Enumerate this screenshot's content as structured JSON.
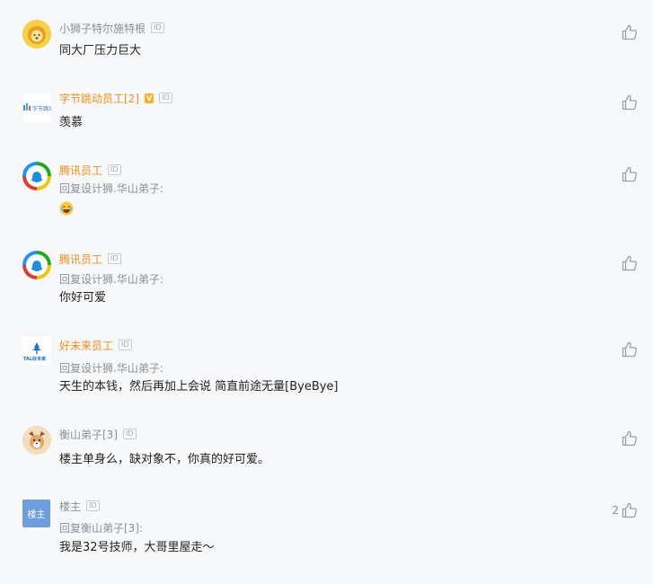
{
  "comments": [
    {
      "author": "小狮子特尔施特根",
      "id_badge": "ID",
      "content": "同大厂压力巨大",
      "like_count": ""
    },
    {
      "author": "字节跳动员工[2]",
      "id_badge": "ID",
      "v_badge": "V",
      "avatar_text": "字节跳动",
      "content": "羡慕",
      "like_count": ""
    },
    {
      "author": "腾讯员工",
      "id_badge": "ID",
      "reply_to": "回复设计狮.华山弟子:",
      "content_emoji": "laugh-emoji",
      "like_count": ""
    },
    {
      "author": "腾讯员工",
      "id_badge": "ID",
      "reply_to": "回复设计狮.华山弟子:",
      "content": "你好可爱",
      "like_count": ""
    },
    {
      "author": "好未来员工",
      "id_badge": "ID",
      "avatar_text": "TAL好未来",
      "reply_to": "回复设计狮.华山弟子:",
      "content": "天生的本钱，然后再加上会说 简直前途无量[ByeBye]",
      "like_count": ""
    },
    {
      "author": "衡山弟子[3]",
      "id_badge": "ID",
      "content": "楼主单身么，缺对象不，你真的好可爱。",
      "like_count": ""
    },
    {
      "author": "楼主",
      "id_badge": "ID",
      "avatar_text": "楼主",
      "reply_to": "回复衡山弟子[3]:",
      "content": "我是32号技师，大哥里屋走～",
      "like_count": "2"
    }
  ],
  "icons": {
    "like": "thumbs-up-icon"
  },
  "colors": {
    "accent_orange": "#f58d1a",
    "muted": "#8a8f99",
    "background": "#f7f8fa"
  }
}
